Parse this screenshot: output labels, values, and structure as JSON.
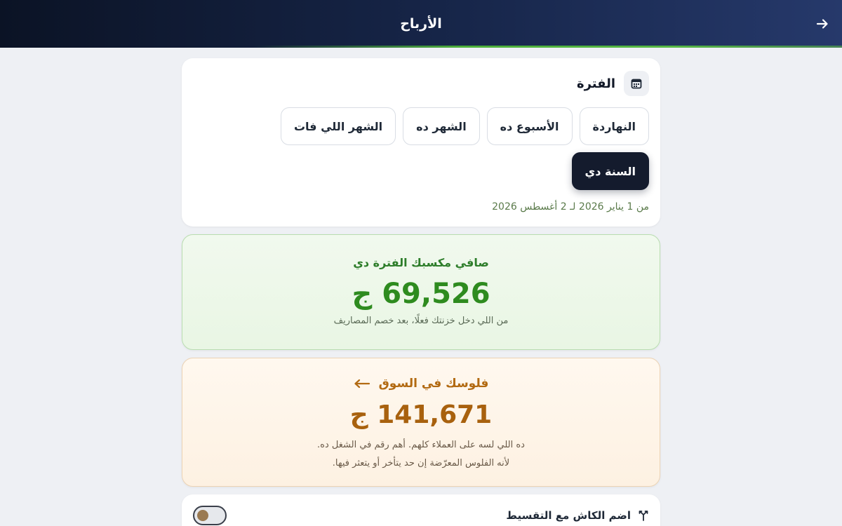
{
  "header": {
    "title": "الأرباح",
    "back_icon": "arrow-right-icon"
  },
  "period": {
    "title": "الفترة",
    "icon": "calendar-icon",
    "options": [
      {
        "label": "النهاردة",
        "selected": false
      },
      {
        "label": "الأسبوع ده",
        "selected": false
      },
      {
        "label": "الشهر ده",
        "selected": false
      },
      {
        "label": "الشهر اللي فات",
        "selected": false
      },
      {
        "label": "السنة دي",
        "selected": true
      }
    ],
    "range_text": "من 1 يناير 2026 لـ 2 أغسطس 2026"
  },
  "net_profit": {
    "label": "صافي مكسبك الفترة دي",
    "value": "69,526 ج",
    "note": "من اللي دخل خزنتك فعلًا، بعد خصم المصاريف",
    "color": "#2e8b1f"
  },
  "market_money": {
    "label": "فلوسك في السوق",
    "icon": "arrow-left-icon",
    "value": "141,671 ج",
    "note_line1": "ده اللي لسه على العملاء كلهم. أهم رقم في الشغل ده.",
    "note_line2": "لأنه الفلوس المعرّضة إن حد يتأخر أو يتعثر فيها.",
    "color": "#a8610e"
  },
  "toggle": {
    "label": "اضم الكاش مع التقسيط",
    "icon": "merge-icon",
    "enabled": false
  }
}
